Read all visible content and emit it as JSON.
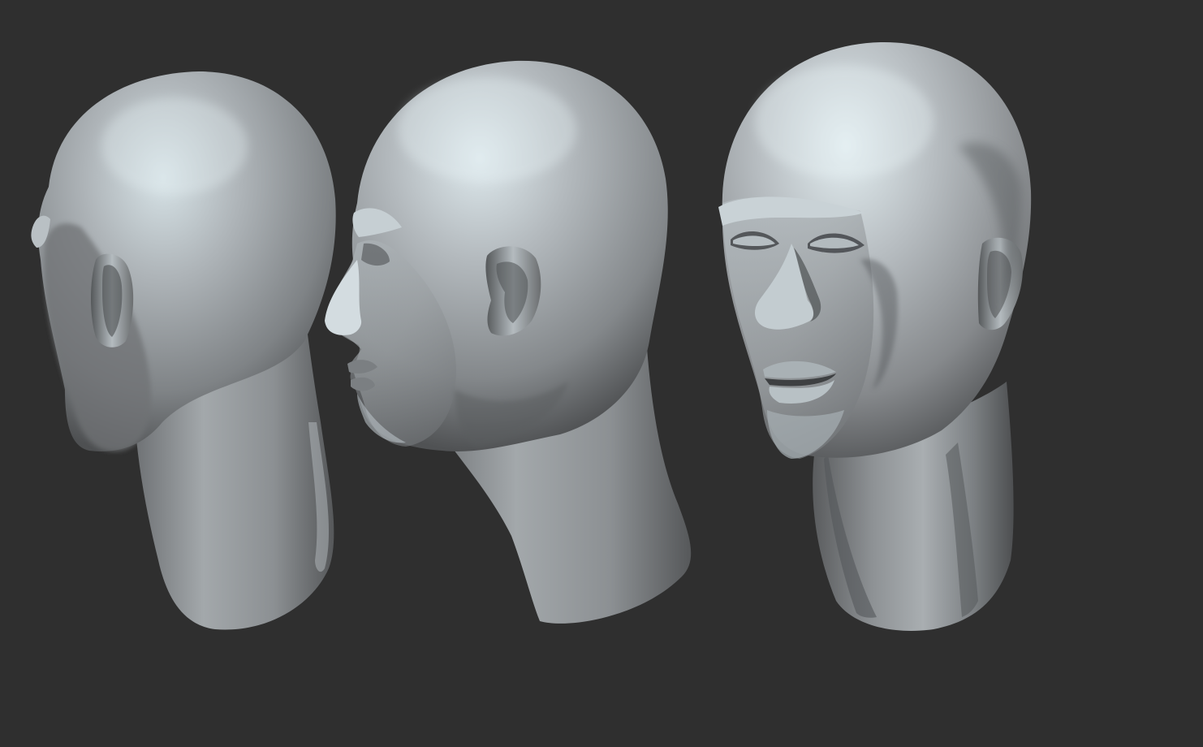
{
  "viewport": {
    "background_color": "#2f2f2f",
    "mesh_color": "#9a9ea2",
    "highlight_color": "#e1eef2",
    "shadow_color": "#3f4142"
  },
  "models": [
    {
      "name": "head-back-three-quarter"
    },
    {
      "name": "head-profile-left"
    },
    {
      "name": "head-front-three-quarter"
    }
  ]
}
